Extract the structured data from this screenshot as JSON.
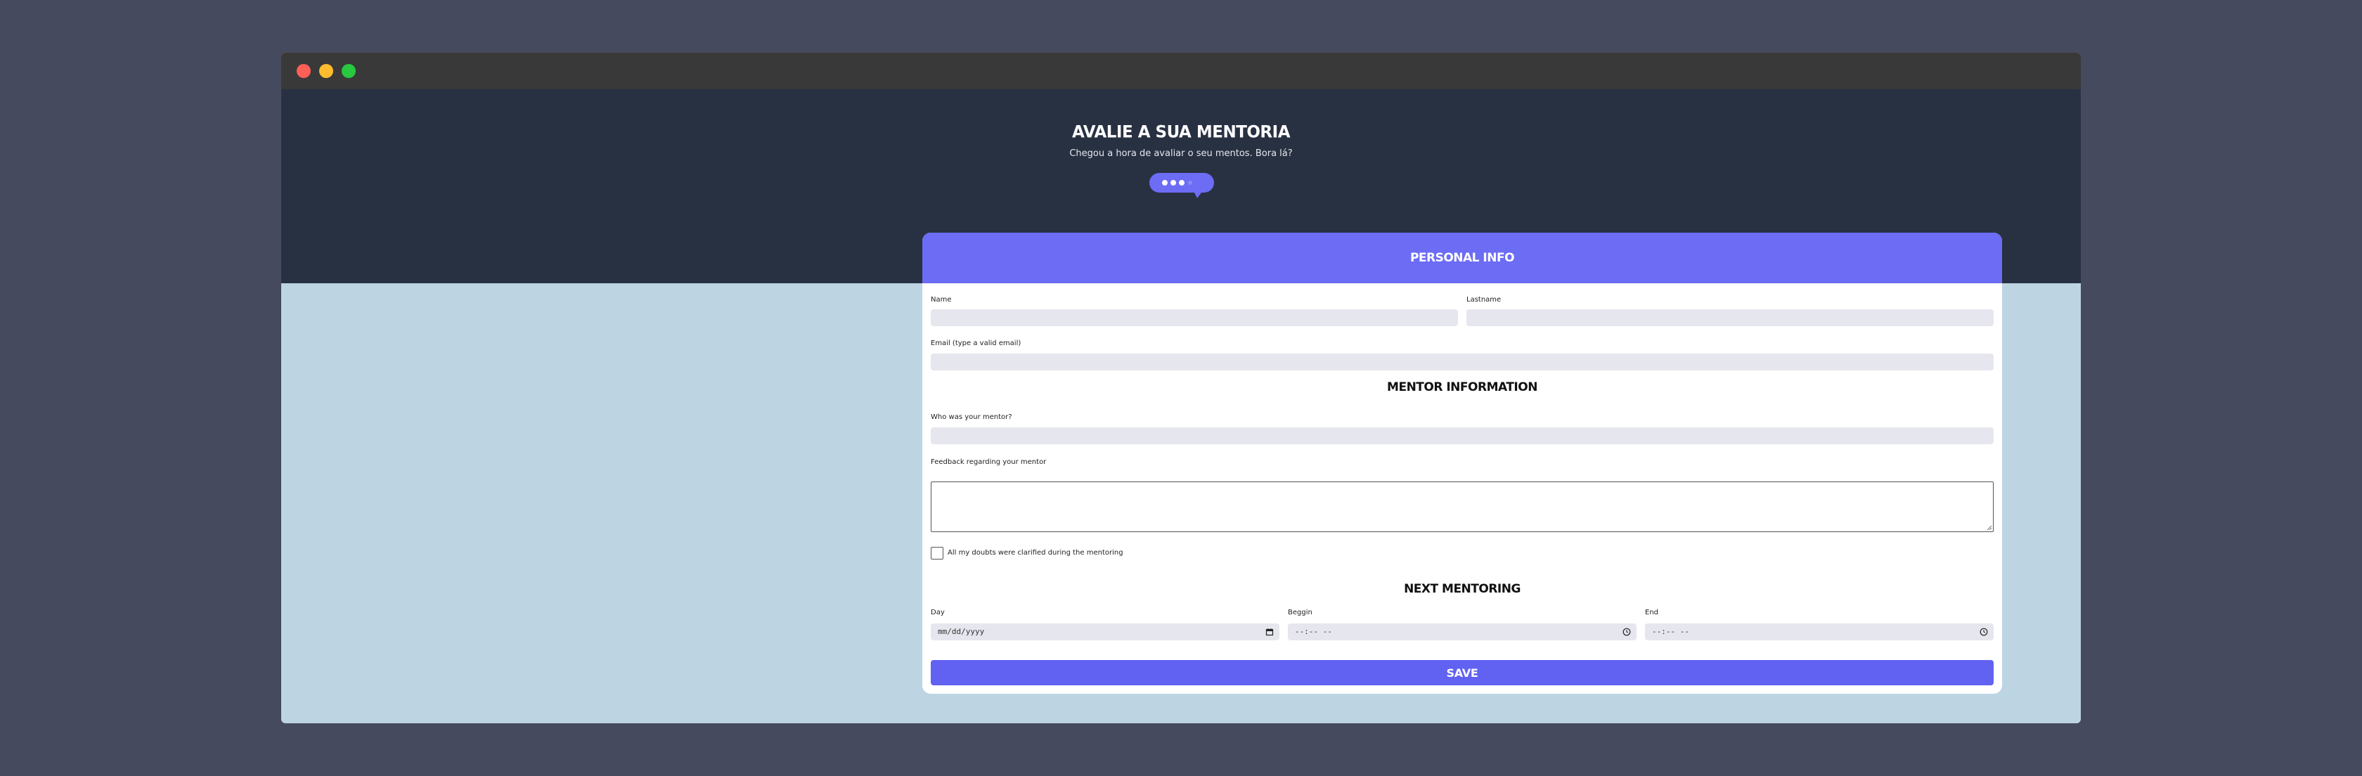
{
  "hero": {
    "title": "AVALIE A SUA MENTORIA",
    "subtitle": "Chegou a hora de avaliar o seu mentos. Bora lá?"
  },
  "personal_info": {
    "header": "PERSONAL INFO",
    "name_label": "Name",
    "name_value": "",
    "lastname_label": "Lastname",
    "lastname_value": "",
    "email_label": "Email (type a valid email)",
    "email_value": ""
  },
  "mentor_info": {
    "title": "MENTOR INFORMATION",
    "mentor_label": "Who was your mentor?",
    "mentor_value": "",
    "feedback_label": "Feedback regarding your mentor",
    "feedback_value": "",
    "doubts_label": "All my doubts were clarified during the mentoring",
    "doubts_checked": false
  },
  "next_mentoring": {
    "title": "NEXT MENTORING",
    "day_label": "Day",
    "day_placeholder": "mm/dd/yyyy",
    "begin_label": "Beggin",
    "begin_placeholder": "--:-- --",
    "end_label": "End",
    "end_placeholder": "--:-- --"
  },
  "actions": {
    "save_label": "SAVE"
  },
  "colors": {
    "accent": "#6c6cf5",
    "hero_bg": "#283142",
    "page_bg": "#bdd5e3",
    "outer_bg": "#464a5e"
  },
  "icons": {
    "bubble": "chat-bubble-icon",
    "calendar": "calendar-icon",
    "clock": "clock-icon"
  }
}
